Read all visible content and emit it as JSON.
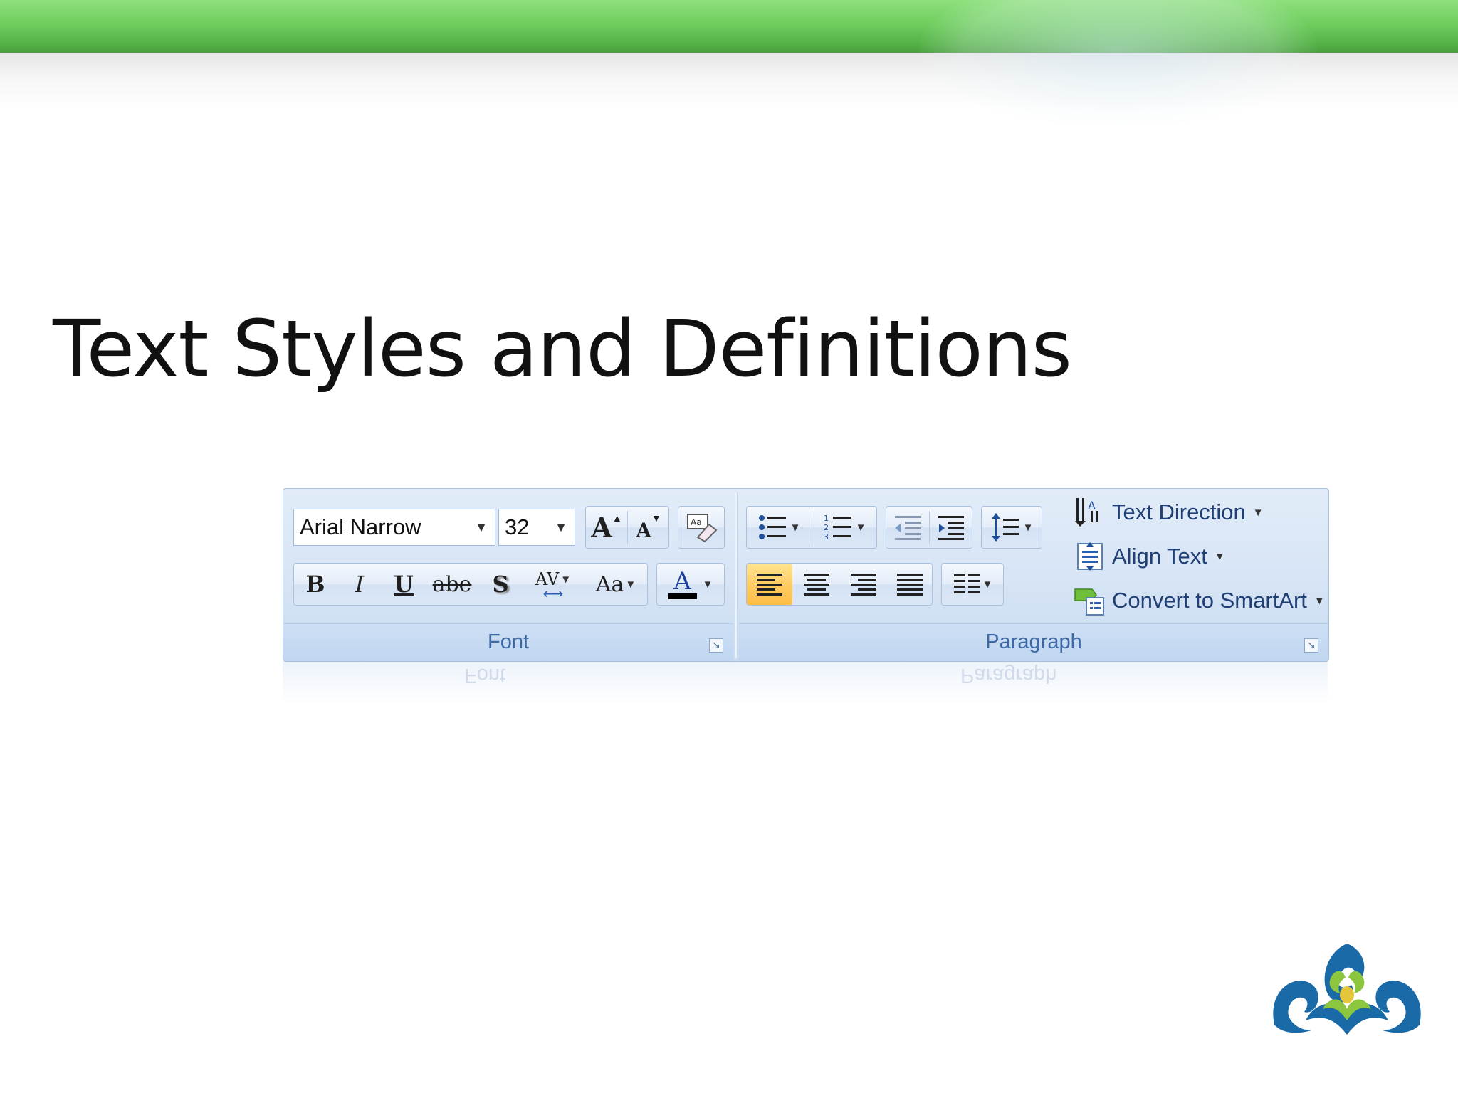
{
  "slide": {
    "title": "Text Styles and Definitions"
  },
  "ribbon": {
    "font_group": {
      "label": "Font",
      "font_name": "Arial Narrow",
      "font_size": "32",
      "grow_font_icon": "A",
      "shrink_font_icon": "A",
      "clear_formatting_icon": "Aa",
      "bold": "B",
      "italic": "I",
      "underline": "U",
      "strikethrough": "abe",
      "shadow": "S",
      "char_spacing": "AV",
      "change_case": "Aa",
      "font_color": "A",
      "font_color_value": "#000000"
    },
    "paragraph_group": {
      "label": "Paragraph",
      "commands": {
        "text_direction": "Text Direction",
        "align_text": "Align Text",
        "convert_smartart": "Convert to SmartArt"
      }
    }
  },
  "colors": {
    "banner_green": "#6fce5e",
    "ribbon_blue": "#d6e4f5",
    "active_highlight": "#ffcb5e",
    "logo_blue": "#1a6aa8",
    "logo_green": "#8cc63f"
  }
}
